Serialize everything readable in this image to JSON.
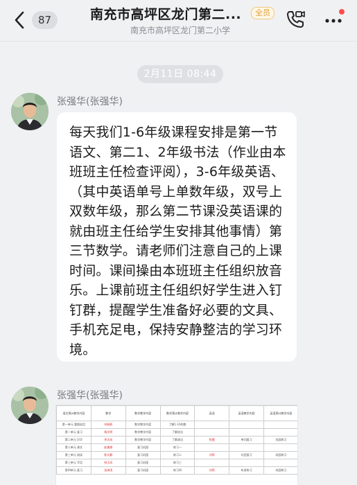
{
  "header": {
    "unread_count": "87",
    "title": "南充市高坪区龙门第二...",
    "member_tag": "全员",
    "subtitle": "南充市高坪区龙门第二小学",
    "icons": {
      "back": "chevron-left-icon",
      "call": "phone-video-icon",
      "more": "more-dots-icon"
    },
    "notification_dot_color": "#ff4d4f"
  },
  "timestamp": "2月11日 08:44",
  "messages": [
    {
      "sender": "张强华(张强华)",
      "text": "每天我们1-6年级课程安排是第一节语文、第二1、2年级书法（作业由本班班主任检查评阅），3-6年级英语、（其中英语单号上单数年级，双号上双数年级，那么第二节课没英语课的就由班主任给学生安排其他事情）第三节数学。请老师们注意自己的上课时间。课间操由本班班主任组织放音乐。上课前班主任组织好学生进入钉钉群，提醒学生准备好必要的文具、手机充足电，保持安静整洁的学习环境。"
    },
    {
      "sender": "张强华(张强华)",
      "image_table": {
        "headers": [
          "语文预计教学内容",
          "数学",
          "数学教学内容",
          "数学预计教学内容",
          "英语",
          "英语教学内容",
          "英语预计教学内容"
        ],
        "rows": [
          [
            "第一单元 看图说话",
            "刘晓燕",
            "数学教学内容",
            "了解1-10的数",
            "",
            "",
            ""
          ],
          [
            "第一单元 复习",
            "杨光明",
            "数学教学内容",
            "了解加法",
            "",
            "",
            ""
          ],
          [
            "第二单元 识字",
            "李天成",
            "数学教学内容",
            "了解减法",
            "陈霞",
            "单词复习",
            "巩固练习"
          ],
          [
            "第二单元 课文",
            "赵美娜",
            "复习巩固",
            "练习一",
            "",
            "",
            ""
          ],
          [
            "第三单元 阅读",
            "陈文静",
            "复习巩固",
            "练习二",
            "刘莉",
            "句型复习",
            "巩固练习"
          ],
          [
            "第三单元 写话",
            "林玉凤",
            "复习巩固",
            "练习三",
            "",
            "",
            ""
          ],
          [
            "第四单元 复习",
            "张海涛",
            "复习巩固",
            "练习四",
            "刘莉",
            "听说练习",
            "巩固练习"
          ]
        ]
      }
    }
  ]
}
